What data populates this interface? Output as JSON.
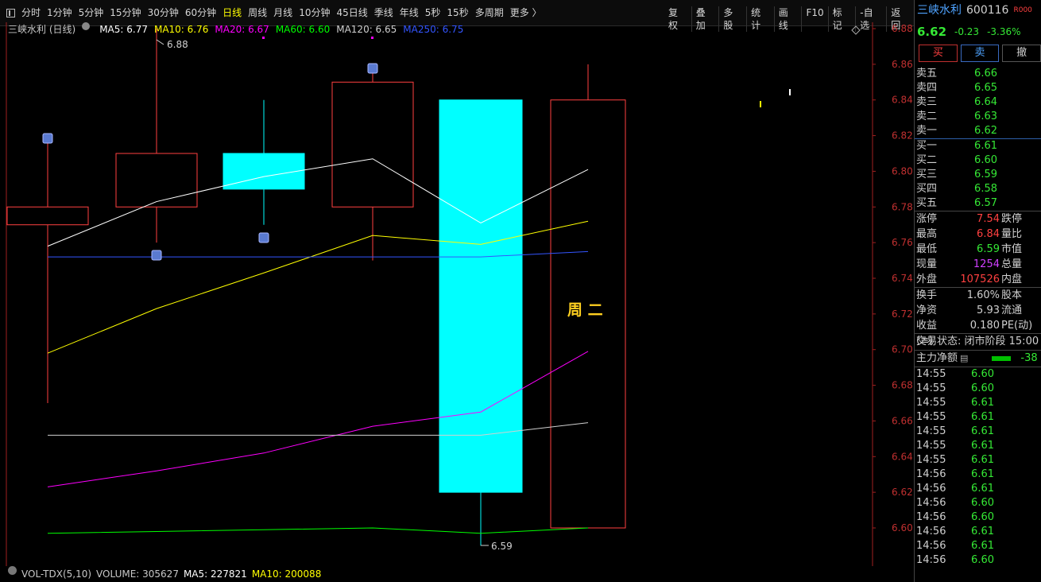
{
  "toolbar": {
    "periods": [
      "分时",
      "1分钟",
      "5分钟",
      "15分钟",
      "30分钟",
      "60分钟",
      "日线",
      "周线",
      "月线",
      "10分钟",
      "45日线",
      "季线",
      "年线",
      "5秒",
      "15秒",
      "多周期",
      "更多 〉"
    ],
    "active_period": "日线",
    "right_buttons": [
      "复权",
      "叠加",
      "多股",
      "统计",
      "画线",
      "F10",
      "标记",
      "-自选",
      "返回"
    ]
  },
  "infobar": {
    "title": "三峡水利 (日线)",
    "ma": [
      {
        "label": "MA5: 6.77",
        "color": "#ffffff"
      },
      {
        "label": "MA10: 6.76",
        "color": "#ffff00"
      },
      {
        "label": "MA20: 6.67",
        "color": "#ff00ff"
      },
      {
        "label": "MA60: 6.60",
        "color": "#00ff00"
      },
      {
        "label": "MA120: 6.65",
        "color": "#d0d0d0"
      },
      {
        "label": "MA250: 6.75",
        "color": "#3355ff"
      }
    ]
  },
  "chart_data": {
    "type": "candlestick",
    "ylim": [
      6.59,
      6.89
    ],
    "y_ticks": [
      "6.60",
      "6.62",
      "6.64",
      "6.66",
      "6.68",
      "6.70",
      "6.72",
      "6.74",
      "6.76",
      "6.78",
      "6.80",
      "6.82",
      "6.84",
      "6.86",
      "6.88"
    ],
    "candles": [
      {
        "open": 6.78,
        "close": 6.77,
        "high": 6.82,
        "low": 6.67,
        "color": "#ff4040",
        "fill": "none"
      },
      {
        "open": 6.78,
        "close": 6.81,
        "high": 6.88,
        "low": 6.76,
        "color": "#ff4040",
        "fill": "none"
      },
      {
        "open": 6.81,
        "close": 6.79,
        "high": 6.84,
        "low": 6.77,
        "color": "#00ffff",
        "fill": "#00ffff"
      },
      {
        "open": 6.78,
        "close": 6.85,
        "high": 6.86,
        "low": 6.75,
        "color": "#ff4040",
        "fill": "none"
      },
      {
        "open": 6.84,
        "close": 6.62,
        "high": 6.84,
        "low": 6.59,
        "color": "#00ffff",
        "fill": "#00ffff"
      },
      {
        "open": 6.6,
        "close": 6.84,
        "high": 6.86,
        "low": 6.6,
        "color": "#ff4040",
        "fill": "none"
      }
    ],
    "ma_series": [
      {
        "color": "#ffffff",
        "values": [
          6.758,
          6.783,
          6.797,
          6.807,
          6.771,
          6.801
        ]
      },
      {
        "color": "#ffff00",
        "values": [
          6.698,
          6.723,
          6.743,
          6.764,
          6.759,
          6.772
        ]
      },
      {
        "color": "#ff00ff",
        "values": [
          6.623,
          6.632,
          6.642,
          6.657,
          6.665,
          6.699
        ]
      },
      {
        "color": "#00ff00",
        "values": [
          6.597,
          6.598,
          6.599,
          6.6,
          6.597,
          6.6
        ]
      },
      {
        "color": "#d0d0d0",
        "values": [
          6.652,
          6.652,
          6.652,
          6.652,
          6.652,
          6.659
        ]
      },
      {
        "color": "#3355ff",
        "values": [
          6.752,
          6.752,
          6.752,
          6.752,
          6.752,
          6.755
        ]
      }
    ],
    "annotations": {
      "high_label": "6.88",
      "low_label": "6.59",
      "weekday_label": "周 二"
    }
  },
  "stock": {
    "name": "三峡水利",
    "code": "600116",
    "badge": "R",
    "badge_sup": "000",
    "price": "6.62",
    "change": "-0.23",
    "change_pct": "-3.36%"
  },
  "trade_buttons": {
    "buy": "买",
    "sell": "卖",
    "cancel": "撤"
  },
  "orderbook": {
    "asks": [
      {
        "label": "卖五",
        "price": "6.66"
      },
      {
        "label": "卖四",
        "price": "6.65"
      },
      {
        "label": "卖三",
        "price": "6.64"
      },
      {
        "label": "卖二",
        "price": "6.63"
      },
      {
        "label": "卖一",
        "price": "6.62"
      }
    ],
    "bids": [
      {
        "label": "买一",
        "price": "6.61"
      },
      {
        "label": "买二",
        "price": "6.60"
      },
      {
        "label": "买三",
        "price": "6.59"
      },
      {
        "label": "买四",
        "price": "6.58"
      },
      {
        "label": "买五",
        "price": "6.57"
      }
    ]
  },
  "stats": [
    {
      "label": "涨停",
      "value": "7.54",
      "color": "#ff4040",
      "label2": "跌停"
    },
    {
      "label": "最高",
      "value": "6.84",
      "color": "#ff4040",
      "label2": "量比"
    },
    {
      "label": "最低",
      "value": "6.59",
      "color": "#35e835",
      "label2": "市值"
    },
    {
      "label": "现量",
      "value": "1254",
      "color": "#d040ff",
      "label2": "总量"
    },
    {
      "label": "外盘",
      "value": "107526",
      "color": "#ff4040",
      "label2": "内盘"
    }
  ],
  "stats2": [
    {
      "label": "换手",
      "value": "1.60%",
      "color": "#d0d0d0",
      "label2": "股本"
    },
    {
      "label": "净资",
      "value": "5.93",
      "color": "#d0d0d0",
      "label2": "流通"
    },
    {
      "label": "收益(≡)",
      "value": "0.180",
      "color": "#d0d0d0",
      "label2": "PE(动)"
    }
  ],
  "trade_status": "交易状态: 闭市阶段 15:00",
  "main_flow": {
    "label": "主力净额",
    "value": "-38"
  },
  "ticks": [
    {
      "time": "14:55",
      "price": "6.60"
    },
    {
      "time": "14:55",
      "price": "6.60"
    },
    {
      "time": "14:55",
      "price": "6.61"
    },
    {
      "time": "14:55",
      "price": "6.61"
    },
    {
      "time": "14:55",
      "price": "6.61"
    },
    {
      "time": "14:55",
      "price": "6.61"
    },
    {
      "time": "14:55",
      "price": "6.61"
    },
    {
      "time": "14:56",
      "price": "6.61"
    },
    {
      "time": "14:56",
      "price": "6.61"
    },
    {
      "time": "14:56",
      "price": "6.60"
    },
    {
      "time": "14:56",
      "price": "6.60"
    },
    {
      "time": "14:56",
      "price": "6.61"
    },
    {
      "time": "14:56",
      "price": "6.61"
    },
    {
      "time": "14:56",
      "price": "6.60"
    }
  ],
  "volume_bar": {
    "name": "VOL-TDX(5,10)",
    "volume": "VOLUME: 305627",
    "ma5": "MA5: 227821",
    "ma10": "MA10: 200088"
  }
}
